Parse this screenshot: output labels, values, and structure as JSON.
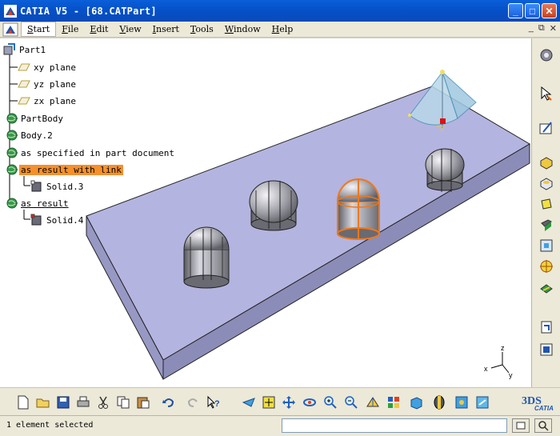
{
  "window": {
    "title": "CATIA V5 - [68.CATPart]",
    "min": "_",
    "max": "□",
    "close": "✕"
  },
  "menubar": {
    "items": [
      "Start",
      "File",
      "Edit",
      "View",
      "Insert",
      "Tools",
      "Window",
      "Help"
    ],
    "mdi": {
      "min": "_",
      "restore": "⧉",
      "close": "✕"
    }
  },
  "tree": {
    "root": "Part1",
    "xy": "xy plane",
    "yz": "yz plane",
    "zx": "zx plane",
    "partbody": "PartBody",
    "body2": "Body.2",
    "spec": "as specified in part document",
    "link": "as result with link",
    "solid3": "Solid.3",
    "result": "as result",
    "solid4": "Solid.4"
  },
  "compass": {
    "x": "x",
    "y": "y",
    "z": "z"
  },
  "brand": {
    "logo_text": "CATIA"
  },
  "status": {
    "text": "1 element selected",
    "command_value": ""
  },
  "colors": {
    "titlebar": "#0a5fd8",
    "plate_top": "#b4b4e0",
    "plate_front": "#8c8cb8",
    "highlight": "#f5902c",
    "selected_part": "#f07818"
  },
  "icons": {
    "bottom": [
      "new-icon",
      "open-icon",
      "save-icon",
      "print-icon",
      "cut-icon",
      "copy-icon",
      "paste-icon",
      "undo-icon",
      "redo-icon",
      "whats-this-icon",
      "fly-mode-icon",
      "fit-all-icon",
      "pan-icon",
      "rotate-icon",
      "zoom-in-icon",
      "zoom-out-icon",
      "normal-view-icon",
      "multi-view-icon",
      "iso-view-icon",
      "shading-icon",
      "hide-show-icon",
      "swap-space-icon"
    ],
    "right": [
      "sketcher-icon",
      "arrow-icon",
      "sketch-icon",
      "pad-icon",
      "pocket-icon",
      "shaft-icon",
      "groove-icon",
      "hole-icon",
      "rib-icon",
      "slot-icon",
      "measure-icon",
      "apply-material-icon"
    ]
  }
}
